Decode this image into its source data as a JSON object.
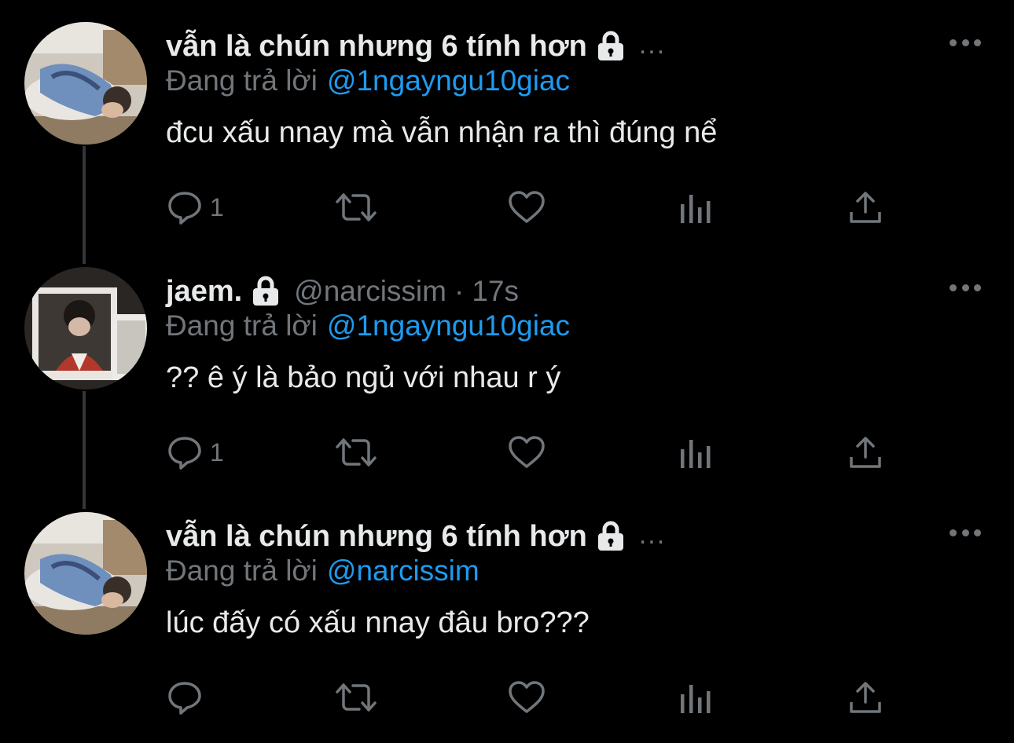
{
  "colors": {
    "background": "#000000",
    "text_primary": "#e7e9ea",
    "text_secondary": "#71767b",
    "mention": "#1d9bf0",
    "thread_line": "#333639"
  },
  "tweets": [
    {
      "display_name": "vẫn là chún nhưng 6 tính hơn",
      "name_overflow": "...",
      "handle": "",
      "separator": "",
      "timestamp": "",
      "reply_prefix": "Đang trả lời",
      "reply_to": "@1ngayngu10giac",
      "text": "đcu xấu nnay mà vẫn nhận ra thì đúng nể",
      "reply_count": "1",
      "avatar": "avatar-photo-lying"
    },
    {
      "display_name": "jaem.",
      "name_overflow": "",
      "handle": "@narcissim",
      "separator": "·",
      "timestamp": "17s",
      "reply_prefix": "Đang trả lời",
      "reply_to": "@1ngayngu10giac",
      "text": "?? ê ý là bảo ngủ với nhau r ý",
      "reply_count": "1",
      "avatar": "avatar-photo-polaroid"
    },
    {
      "display_name": "vẫn là chún nhưng 6 tính hơn",
      "name_overflow": "...",
      "handle": "",
      "separator": "",
      "timestamp": "",
      "reply_prefix": "Đang trả lời",
      "reply_to": "@narcissim",
      "text": "lúc đấy có xấu nnay đâu bro???",
      "reply_count": "",
      "avatar": "avatar-photo-lying"
    }
  ],
  "icons": {
    "lock": "lock-icon",
    "more": "more-options-icon",
    "reply": "reply-icon",
    "retweet": "retweet-icon",
    "like": "heart-icon",
    "views": "views-icon",
    "share": "share-icon"
  }
}
